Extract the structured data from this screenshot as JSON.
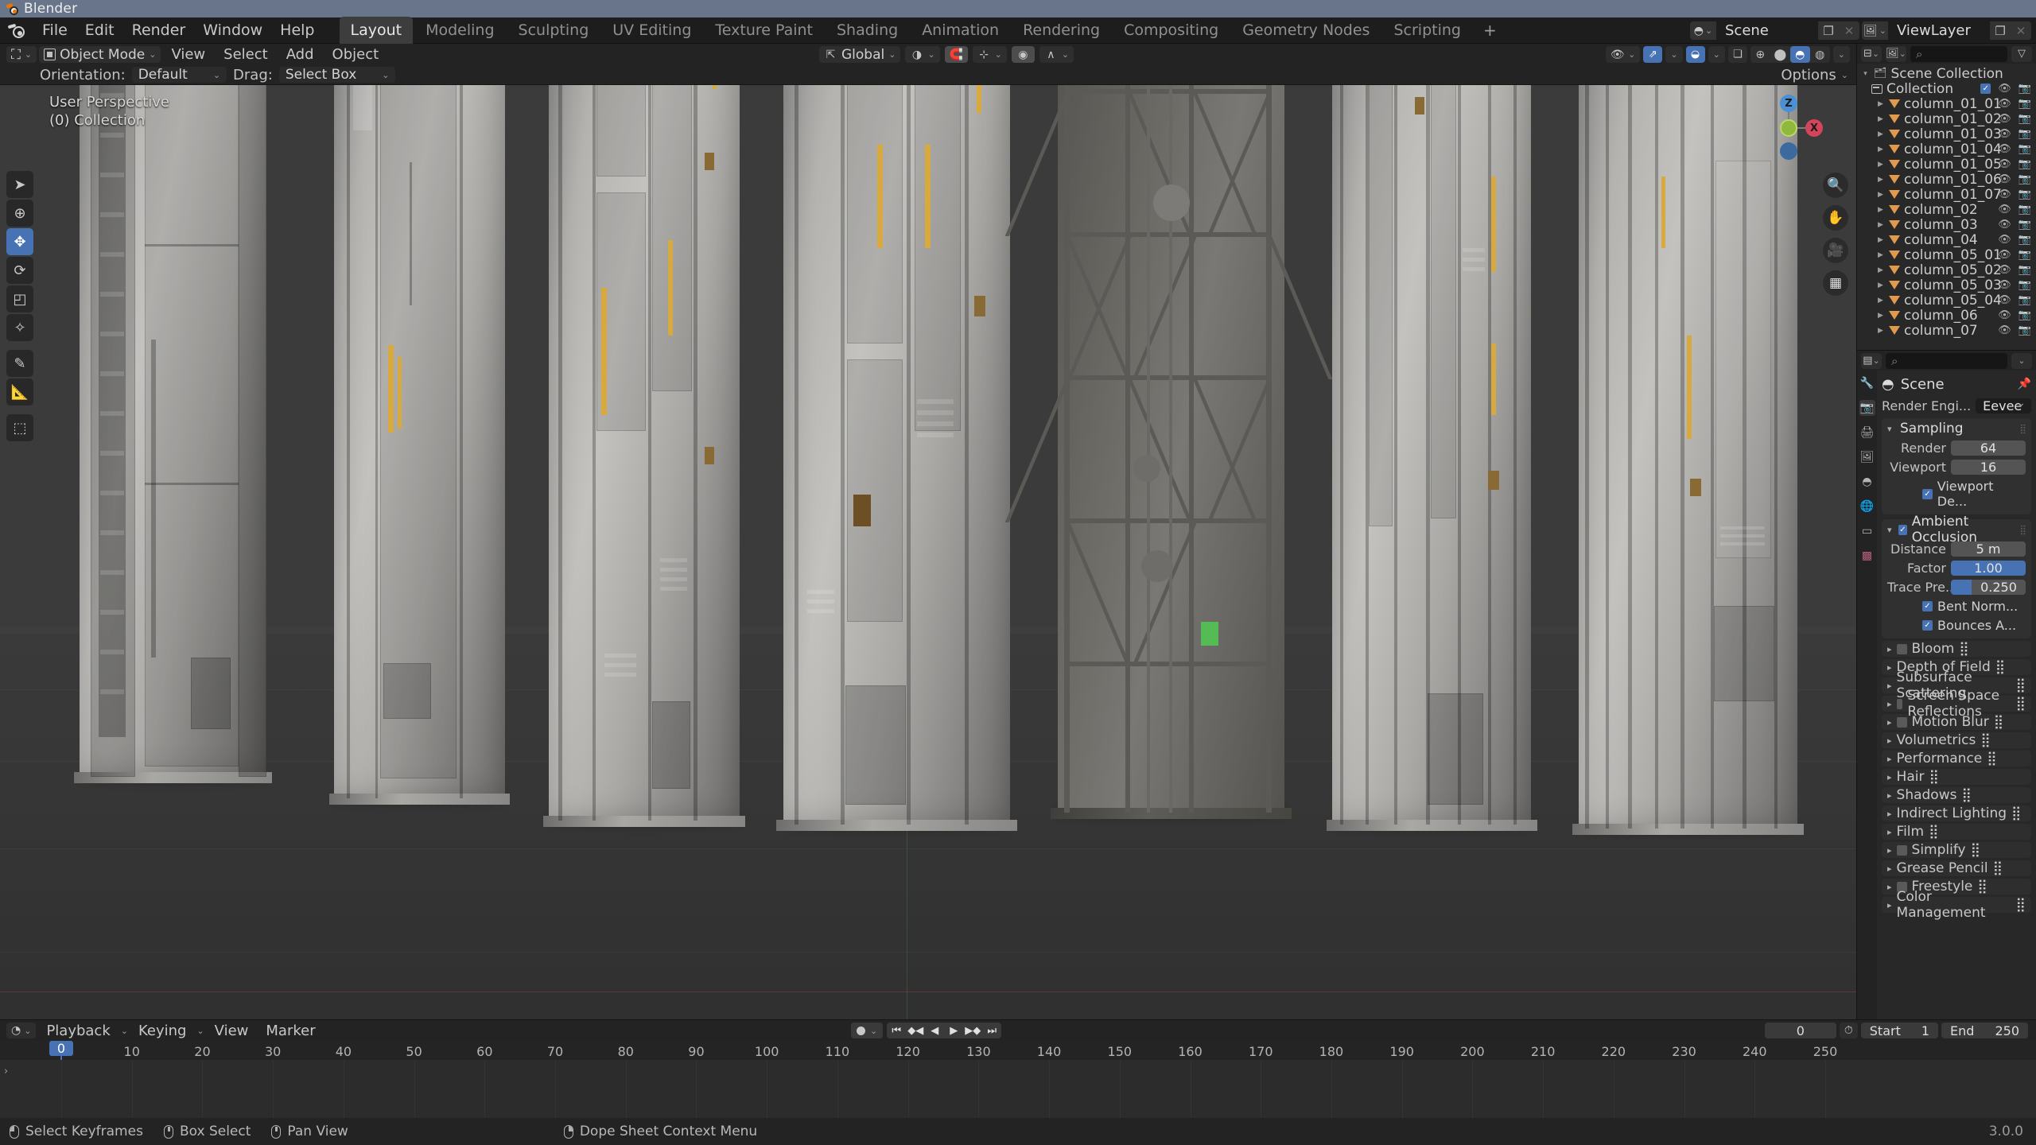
{
  "window": {
    "app_title": "Blender",
    "version": "3.0.0"
  },
  "topbar": {
    "menus": [
      "File",
      "Edit",
      "Render",
      "Window",
      "Help"
    ],
    "workspaces": [
      {
        "label": "Layout",
        "active": true
      },
      {
        "label": "Modeling",
        "active": false
      },
      {
        "label": "Sculpting",
        "active": false
      },
      {
        "label": "UV Editing",
        "active": false
      },
      {
        "label": "Texture Paint",
        "active": false
      },
      {
        "label": "Shading",
        "active": false
      },
      {
        "label": "Animation",
        "active": false
      },
      {
        "label": "Rendering",
        "active": false
      },
      {
        "label": "Compositing",
        "active": false
      },
      {
        "label": "Geometry Nodes",
        "active": false
      },
      {
        "label": "Scripting",
        "active": false
      }
    ],
    "add_workspace": "+",
    "scene_name": "Scene",
    "viewlayer_name": "ViewLayer"
  },
  "viewport_header": {
    "mode": "Object Mode",
    "menus": [
      "View",
      "Select",
      "Add",
      "Object"
    ],
    "transform_orientation": "Global",
    "options_label": "Options"
  },
  "tool_settings": {
    "orientation_label": "Orientation:",
    "orientation_value": "Default",
    "drag_label": "Drag:",
    "drag_value": "Select Box"
  },
  "viewport": {
    "overlay_line1": "User Perspective",
    "overlay_line2": "(0) Collection",
    "gizmo_axes": [
      "Z",
      "X"
    ],
    "tools": [
      "tweak-tool",
      "cursor-tool",
      "move-tool",
      "rotate-tool",
      "scale-tool",
      "transform-tool",
      "annotate-tool",
      "measure-tool",
      "add-cube-tool"
    ],
    "nav_buttons": [
      "zoom-icon",
      "hand-icon",
      "camera-icon",
      "grid-icon"
    ]
  },
  "outliner": {
    "search_placeholder": "",
    "scene_collection": "Scene Collection",
    "collection": "Collection",
    "items": [
      {
        "name": "column_01_01"
      },
      {
        "name": "column_01_02"
      },
      {
        "name": "column_01_03"
      },
      {
        "name": "column_01_04"
      },
      {
        "name": "column_01_05"
      },
      {
        "name": "column_01_06"
      },
      {
        "name": "column_01_07"
      },
      {
        "name": "column_02"
      },
      {
        "name": "column_03"
      },
      {
        "name": "column_04"
      },
      {
        "name": "column_05_01"
      },
      {
        "name": "column_05_02"
      },
      {
        "name": "column_05_03"
      },
      {
        "name": "column_05_04"
      },
      {
        "name": "column_06"
      },
      {
        "name": "column_07"
      }
    ]
  },
  "properties": {
    "search_placeholder": "",
    "id_name": "Scene",
    "render_engine_label": "Render Engi...",
    "render_engine_value": "Eevee",
    "sampling": {
      "title": "Sampling",
      "render_label": "Render",
      "render_value": "64",
      "viewport_label": "Viewport",
      "viewport_value": "16",
      "viewport_denoise_label": "Viewport De..."
    },
    "ambient_occlusion": {
      "title": "Ambient Occlusion",
      "distance_label": "Distance",
      "distance_value": "5 m",
      "factor_label": "Factor",
      "factor_value": "1.00",
      "trace_label": "Trace Pre...",
      "trace_value": "0.250",
      "bent_normals_label": "Bent Norm...",
      "bounces_label": "Bounces A..."
    },
    "collapsed_panels": [
      {
        "title": "Bloom",
        "has_checkbox": true
      },
      {
        "title": "Depth of Field",
        "has_checkbox": false
      },
      {
        "title": "Subsurface Scattering",
        "has_checkbox": false
      },
      {
        "title": "Screen Space Reflections",
        "has_checkbox": true
      },
      {
        "title": "Motion Blur",
        "has_checkbox": true
      },
      {
        "title": "Volumetrics",
        "has_checkbox": false
      },
      {
        "title": "Performance",
        "has_checkbox": false
      },
      {
        "title": "Hair",
        "has_checkbox": false
      },
      {
        "title": "Shadows",
        "has_checkbox": false
      },
      {
        "title": "Indirect Lighting",
        "has_checkbox": false
      },
      {
        "title": "Film",
        "has_checkbox": false
      },
      {
        "title": "Simplify",
        "has_checkbox": true
      },
      {
        "title": "Grease Pencil",
        "has_checkbox": false
      },
      {
        "title": "Freestyle",
        "has_checkbox": true
      },
      {
        "title": "Color Management",
        "has_checkbox": false
      }
    ]
  },
  "timeline": {
    "menus": [
      "Playback",
      "Keying",
      "View",
      "Marker"
    ],
    "current_frame": "0",
    "start_label": "Start",
    "start_value": "1",
    "end_label": "End",
    "end_value": "250",
    "playhead_frame": "0",
    "ruler_ticks": [
      10,
      20,
      30,
      40,
      50,
      60,
      70,
      80,
      90,
      100,
      110,
      120,
      130,
      140,
      150,
      160,
      170,
      180,
      190,
      200,
      210,
      220,
      230,
      240,
      250
    ]
  },
  "status_bar": {
    "items": [
      {
        "mouse": "left",
        "label": "Select Keyframes"
      },
      {
        "mouse": "middle",
        "label": "Box Select"
      },
      {
        "mouse": "middle",
        "label": "Pan View"
      },
      {
        "mouse": "right",
        "label": "Dope Sheet Context Menu"
      }
    ]
  },
  "colors": {
    "accent_blue": "#4772b3",
    "title_bar": "#68758a",
    "mesh_orange": "#e09a4e",
    "panel_bg": "#282828"
  }
}
